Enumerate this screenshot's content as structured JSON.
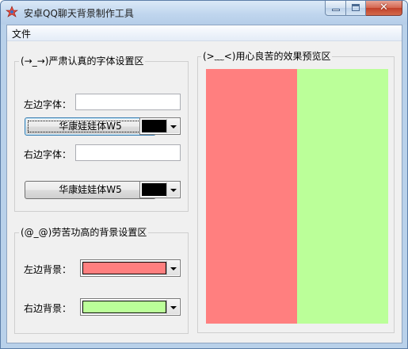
{
  "window": {
    "title": "安卓QQ聊天背景制作工具",
    "close_glyph": "✕"
  },
  "menu": {
    "file_label": "文件"
  },
  "font_group": {
    "legend": "(→_→)严肃认真的字体设置区",
    "left_font_label": "左边字体：",
    "left_font_value": "",
    "left_font_button": "华康娃娃体W5",
    "left_font_color": "#000000",
    "right_font_label": "右边字体：",
    "right_font_value": "",
    "right_font_button": "华康娃娃体W5",
    "right_font_color": "#000000"
  },
  "bg_group": {
    "legend": "(@_@)劳苦功高的背景设置区",
    "left_bg_label": "左边背景：",
    "left_bg_color": "#ff7f7f",
    "right_bg_label": "右边背景：",
    "right_bg_color": "#bbff99"
  },
  "preview_group": {
    "legend": "(>﹏<)用心良苦的效果预览区",
    "left_color": "#ff7f7f",
    "right_color": "#bbff99"
  }
}
